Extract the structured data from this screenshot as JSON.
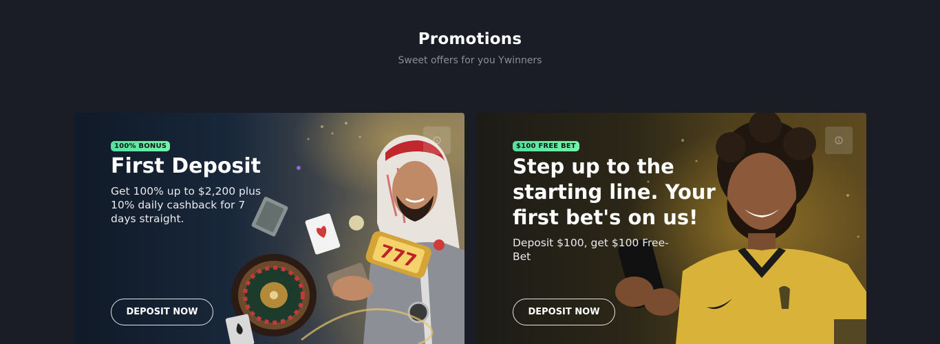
{
  "header": {
    "title": "Promotions",
    "subtitle": "Sweet offers for you Ywinners"
  },
  "promos": [
    {
      "badge": "100% BONUS",
      "title": "First Deposit",
      "description": "Get 100% up to $2,200 plus 10% daily cashback for 7 days straight.",
      "button_label": "DEPOSIT NOW",
      "slot_reel_text": "777"
    },
    {
      "badge": "$100 FREE BET",
      "title": "Step up to the starting line. Your first bet's on us!",
      "description": "Deposit $100, get $100 Free-Bet",
      "button_label": "DEPOSIT NOW"
    }
  ],
  "icons": {
    "info": "info-icon",
    "roulette": "roulette-wheel-icon",
    "card": "playing-card-icon",
    "slot": "slot-machine-icon",
    "player": "football-player-image",
    "phone": "phone-icon"
  },
  "colors": {
    "page_bg": "#1b1d26",
    "badge_green": "#56e0a0",
    "subtitle_gray": "#8a8d98",
    "jersey_yellow": "#d9b23a"
  }
}
